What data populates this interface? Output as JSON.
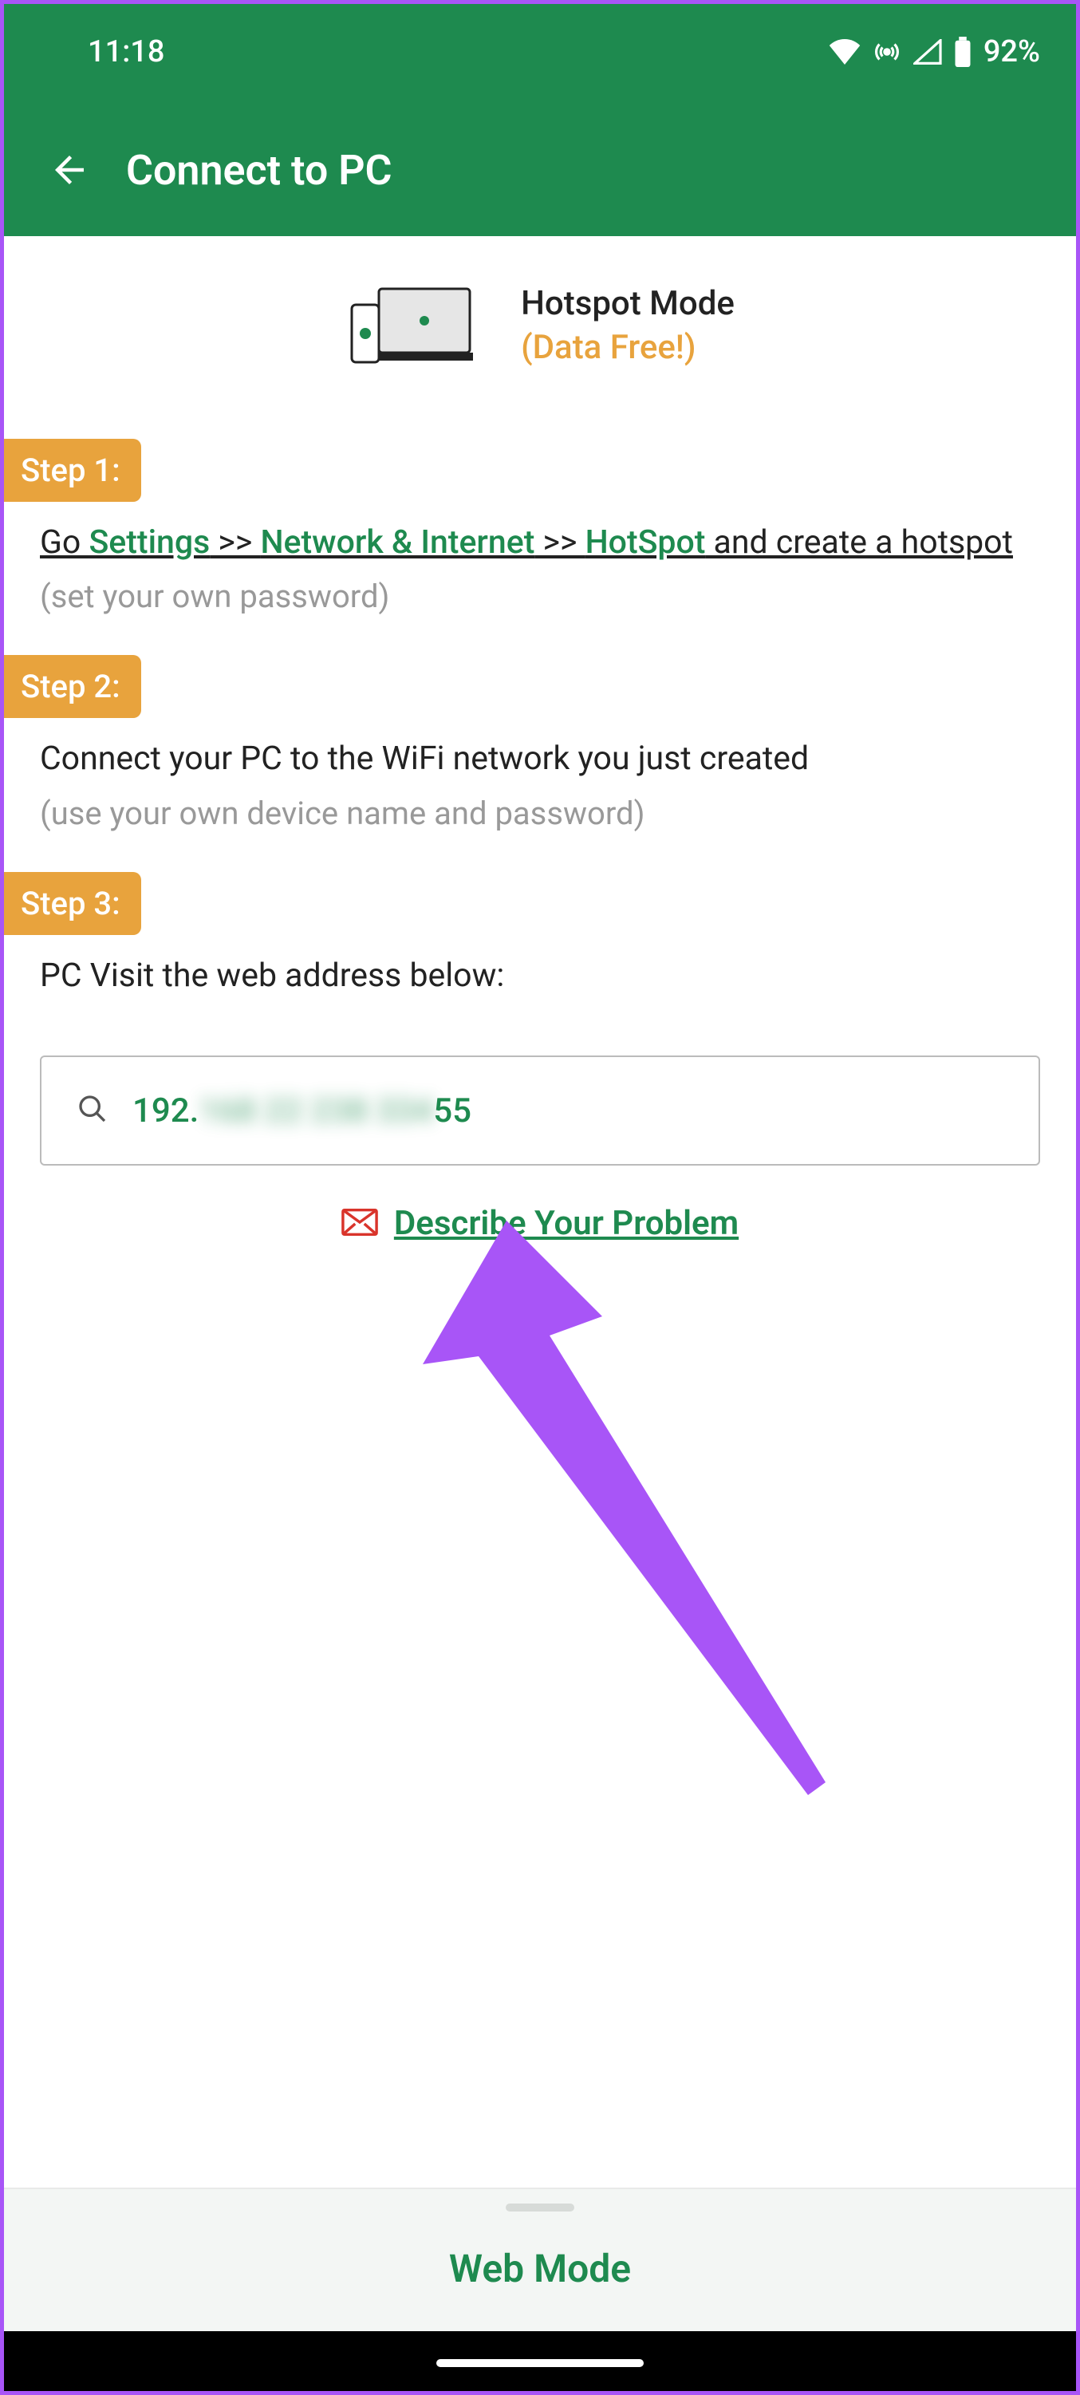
{
  "status": {
    "time": "11:18",
    "battery": "92%"
  },
  "appbar": {
    "title": "Connect to PC"
  },
  "hotspot": {
    "title": "Hotspot Mode",
    "subtitle": "(Data Free!)"
  },
  "steps": {
    "s1": {
      "badge": "Step 1:",
      "text_go": "Go ",
      "link_settings": "Settings",
      "arrow1": " >> ",
      "link_network": "Network & Internet",
      "arrow2": " >> ",
      "link_hotspot": "HotSpot",
      "text_rest": " and create a hotspot",
      "hint": "(set your own password)"
    },
    "s2": {
      "badge": "Step 2:",
      "text": "Connect your PC to the WiFi network you just created",
      "hint": "(use your own device name and password)"
    },
    "s3": {
      "badge": "Step 3:",
      "text": "PC Visit the web address below:"
    }
  },
  "address": {
    "prefix": "192.",
    "blurred": "168 22 238 334",
    "suffix": "55"
  },
  "describe": {
    "label": "Describe Your Problem"
  },
  "bottom": {
    "mode": "Web Mode"
  }
}
